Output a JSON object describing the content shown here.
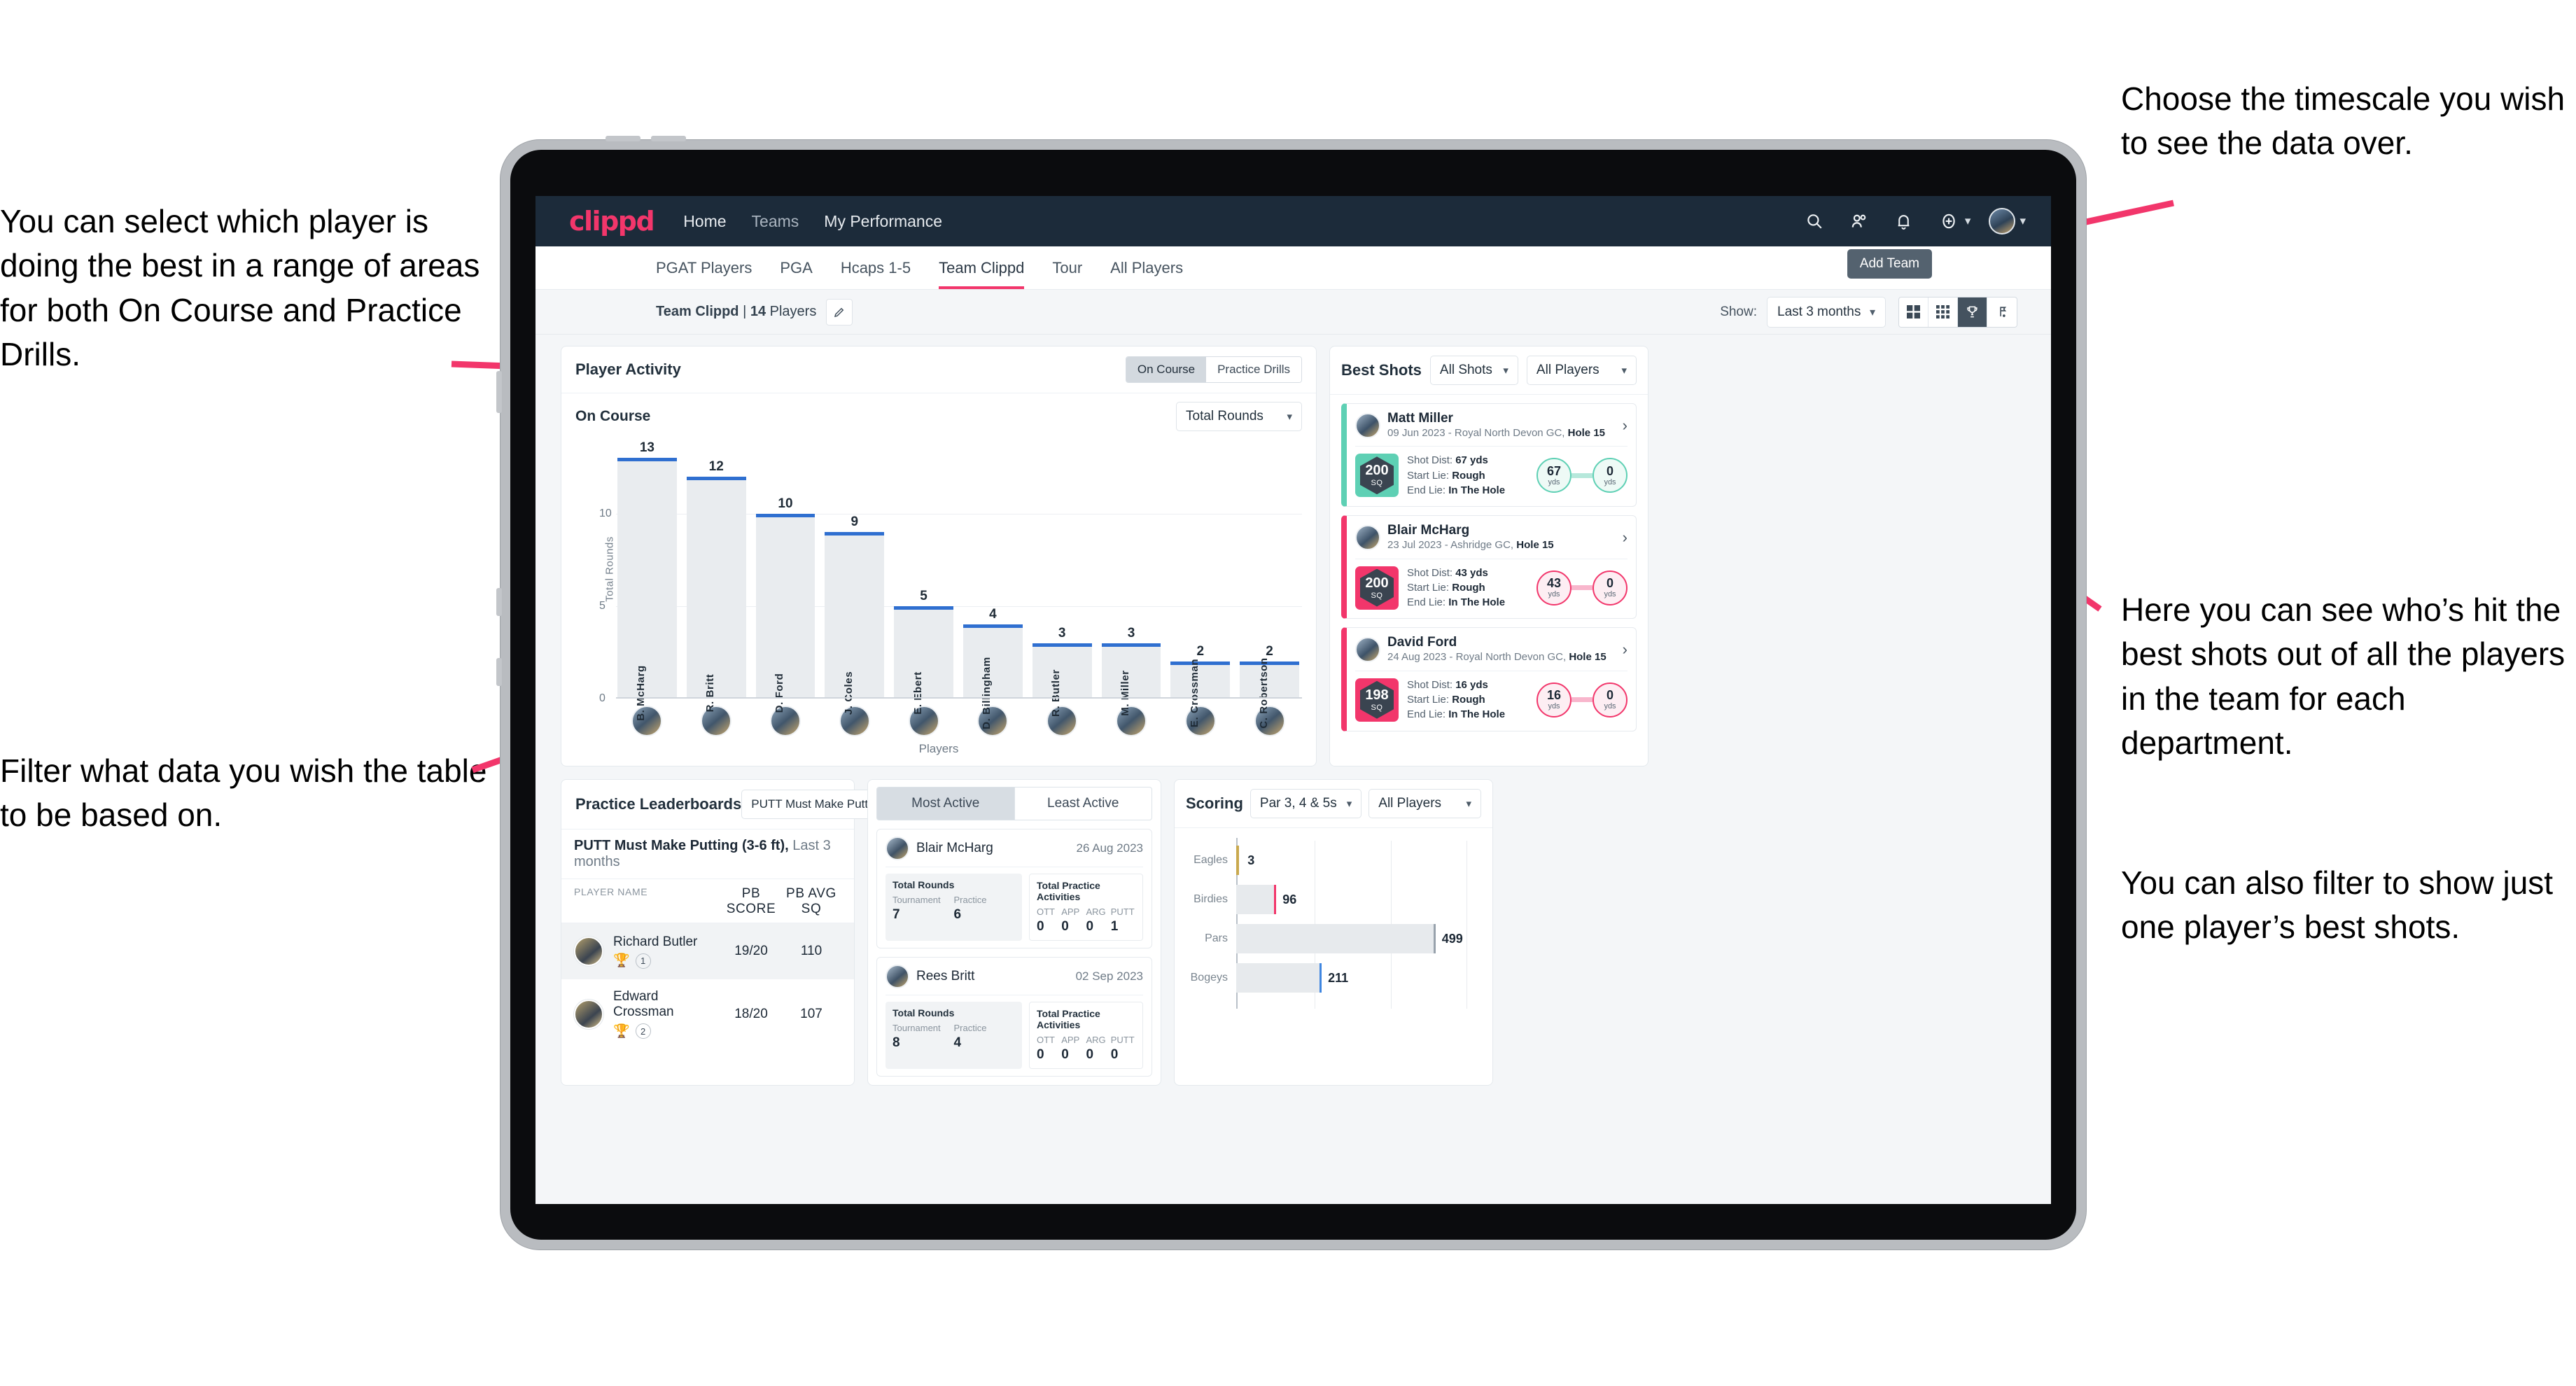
{
  "annotations": {
    "top_left": "You can select which player is doing the best in a range of areas for both On Course and Practice Drills.",
    "bottom_left": "Filter what data you wish the table to be based on.",
    "top_right": "Choose the timescale you wish to see the data over.",
    "mid_right": "Here you can see who’s hit the best shots out of all the players in the team for each department.",
    "bottom_right": "You can also filter to show just one player’s best shots."
  },
  "colors": {
    "brand_pink": "#f2366b",
    "nav_dark": "#1c2b3a",
    "bar_blue": "#2f6fd0",
    "teal": "#5ed0b4",
    "gold": "#c9a94e"
  },
  "topnav": {
    "logo": "clippd",
    "links": [
      {
        "label": "Home"
      },
      {
        "label": "Teams"
      },
      {
        "label": "My Performance"
      }
    ],
    "icons": [
      {
        "name": "search-icon"
      },
      {
        "name": "people-icon"
      },
      {
        "name": "bell-icon"
      },
      {
        "name": "plus-circle-icon"
      }
    ]
  },
  "tabs": [
    {
      "label": "PGAT Players",
      "active": false
    },
    {
      "label": "PGA",
      "active": false
    },
    {
      "label": "Hcaps 1-5",
      "active": false
    },
    {
      "label": "Team Clippd",
      "active": true
    },
    {
      "label": "Tour",
      "active": false
    },
    {
      "label": "All Players",
      "active": false
    }
  ],
  "tooltip": {
    "add_team": "Add Team"
  },
  "subheader": {
    "team_name": "Team Clippd",
    "separator": " | ",
    "player_count": "14",
    "players_word": " Players",
    "edit_icon": "pencil-icon",
    "show_label": "Show:",
    "timescale_value": "Last 3 months",
    "view_buttons": [
      {
        "name": "grid-large-view",
        "selected": false
      },
      {
        "name": "grid-small-view",
        "selected": false
      },
      {
        "name": "trophy-view",
        "selected": true
      },
      {
        "name": "flag-view",
        "selected": false
      }
    ]
  },
  "player_activity": {
    "title": "Player Activity",
    "segment": [
      {
        "label": "On Course",
        "selected": true
      },
      {
        "label": "Practice Drills",
        "selected": false
      }
    ],
    "sub_label": "On Course",
    "metric_select": "Total Rounds"
  },
  "best_shots": {
    "title": "Best Shots",
    "shot_filter": "All Shots",
    "player_filter": "All Players",
    "items": [
      {
        "player": "Matt Miller",
        "meta_date": "09 Jun 2023 - Royal North Devon GC, ",
        "meta_hole": "Hole 15",
        "sq": "200",
        "sq_unit": "SQ",
        "accent": "teal",
        "shot_dist_label": "Shot Dist: ",
        "shot_dist": "67 yds",
        "start_lie_label": "Start Lie: ",
        "start_lie": "Rough",
        "end_lie_label": "End Lie: ",
        "end_lie": "In The Hole",
        "from_val": "67",
        "from_unit": "yds",
        "to_val": "0",
        "to_unit": "yds"
      },
      {
        "player": "Blair McHarg",
        "meta_date": "23 Jul 2023 - Ashridge GC, ",
        "meta_hole": "Hole 15",
        "sq": "200",
        "sq_unit": "SQ",
        "accent": "pink",
        "shot_dist_label": "Shot Dist: ",
        "shot_dist": "43 yds",
        "start_lie_label": "Start Lie: ",
        "start_lie": "Rough",
        "end_lie_label": "End Lie: ",
        "end_lie": "In The Hole",
        "from_val": "43",
        "from_unit": "yds",
        "to_val": "0",
        "to_unit": "yds"
      },
      {
        "player": "David Ford",
        "meta_date": "24 Aug 2023 - Royal North Devon GC, ",
        "meta_hole": "Hole 15",
        "sq": "198",
        "sq_unit": "SQ",
        "accent": "pink",
        "shot_dist_label": "Shot Dist: ",
        "shot_dist": "16 yds",
        "start_lie_label": "Start Lie: ",
        "start_lie": "Rough",
        "end_lie_label": "End Lie: ",
        "end_lie": "In The Hole",
        "from_val": "16",
        "from_unit": "yds",
        "to_val": "0",
        "to_unit": "yds"
      }
    ]
  },
  "practice_leaderboards": {
    "title": "Practice Leaderboards",
    "drill_select": "PUTT Must Make Putting ...",
    "drill_name": "PUTT Must Make Putting (3-6 ft),",
    "drill_period": " Last 3 months",
    "columns": [
      "PLAYER NAME",
      "PB SCORE",
      "PB AVG SQ"
    ],
    "rows": [
      {
        "name": "Richard Butler",
        "rank": "1",
        "trophy": "gold",
        "pb_score": "19/20",
        "pb_avg_sq": "110"
      },
      {
        "name": "Edward Crossman",
        "rank": "2",
        "trophy": "silver",
        "pb_score": "18/20",
        "pb_avg_sq": "107"
      }
    ]
  },
  "activity": {
    "tabs": [
      {
        "label": "Most Active",
        "selected": true
      },
      {
        "label": "Least Active",
        "selected": false
      }
    ],
    "rounds_title": "Total Rounds",
    "practice_title": "Total Practice Activities",
    "rounds_keys": [
      "Tournament",
      "Practice"
    ],
    "practice_keys": [
      "OTT",
      "APP",
      "ARG",
      "PUTT"
    ],
    "items": [
      {
        "name": "Blair McHarg",
        "date": "26 Aug 2023",
        "rounds": [
          "7",
          "6"
        ],
        "practice": [
          "0",
          "0",
          "0",
          "1"
        ]
      },
      {
        "name": "Rees Britt",
        "date": "02 Sep 2023",
        "rounds": [
          "8",
          "4"
        ],
        "practice": [
          "0",
          "0",
          "0",
          "0"
        ]
      }
    ]
  },
  "scoring": {
    "title": "Scoring",
    "par_filter": "Par 3, 4 & 5s",
    "player_filter": "All Players"
  },
  "chart_data": [
    {
      "type": "bar",
      "title": "Player Activity",
      "xlabel": "Players",
      "ylabel": "Total Rounds",
      "categories": [
        "B. McHarg",
        "R. Britt",
        "D. Ford",
        "J. Coles",
        "E. Ebert",
        "D. Billingham",
        "R. Butler",
        "M. Miller",
        "E. Crossman",
        "C. Robertson"
      ],
      "values": [
        13,
        12,
        10,
        9,
        5,
        4,
        3,
        3,
        2,
        2
      ],
      "ylim": [
        0,
        14
      ],
      "yticks": [
        0,
        5,
        10
      ],
      "grid": true,
      "legend": "none"
    },
    {
      "type": "bar",
      "title": "Scoring",
      "orientation": "horizontal",
      "categories": [
        "Eagles",
        "Birdies",
        "Pars",
        "Bogeys"
      ],
      "values": [
        3,
        96,
        499,
        211
      ],
      "xlabel": "",
      "ylabel": "",
      "xlim": [
        0,
        620
      ],
      "grid": true,
      "legend": "none"
    }
  ]
}
